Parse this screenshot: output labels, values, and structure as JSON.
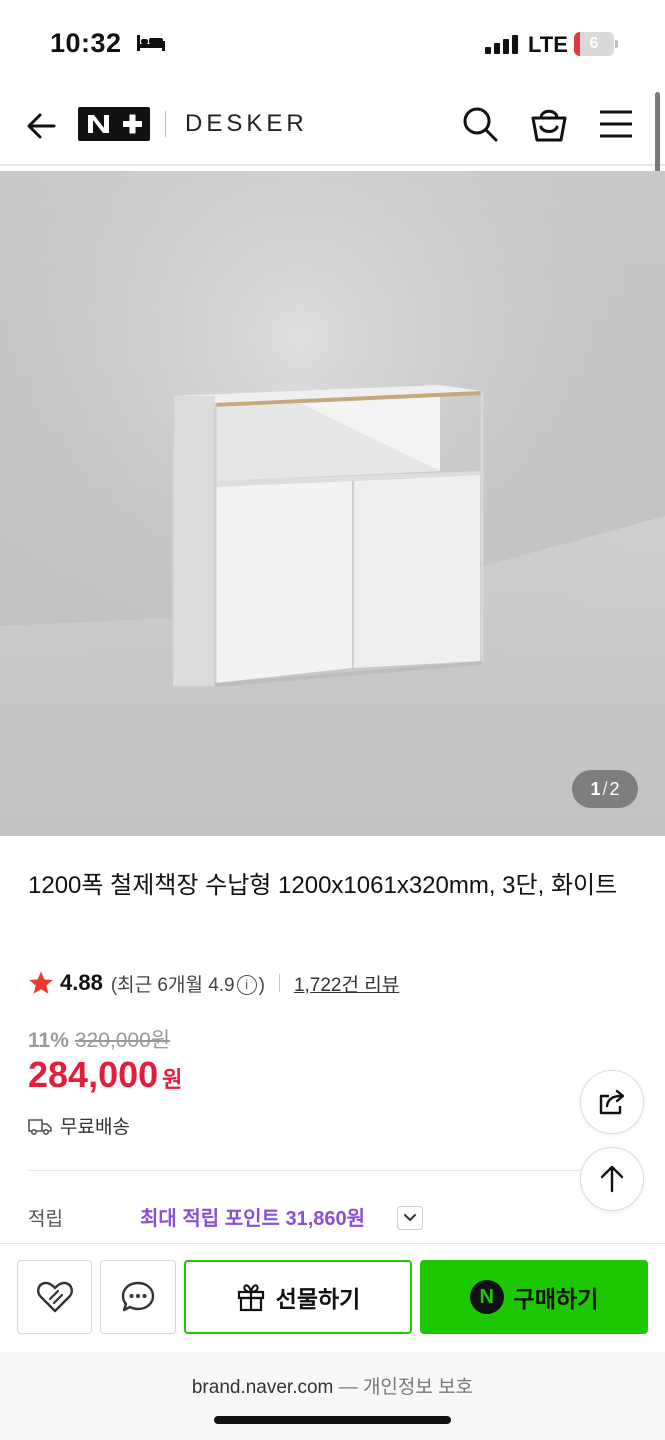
{
  "status_bar": {
    "time": "10:32",
    "network": "LTE",
    "battery_level": "6",
    "battery_color": "#e03a3a"
  },
  "header": {
    "logo_text": "N+",
    "brand": "DESKER",
    "icons": [
      "back-arrow-icon",
      "search-icon",
      "shopping-bag-icon",
      "hamburger-menu-icon"
    ]
  },
  "gallery": {
    "current": "1",
    "separator": "/",
    "total": "2"
  },
  "product": {
    "title": "1200폭 철제책장 수납형 1200x1061x320mm, 3단, 화이트",
    "rating": "4.88",
    "recent_rating_prefix": "(최근 6개월 4.9",
    "recent_rating_suffix": ")",
    "info_glyph": "i",
    "review_count": "1,722건 리뷰",
    "discount_rate": "11%",
    "original_price": "320,000원",
    "sale_price": "284,000",
    "currency": "원",
    "shipping": "무료배송",
    "points_label": "적립",
    "points_value": "최대 적립 포인트 31,860원"
  },
  "actions": {
    "gift_label": "선물하기",
    "buy_label": "구매하기",
    "npay_glyph": "N",
    "accent_color": "#1ec800"
  },
  "footer": {
    "domain": "brand.naver.com",
    "separator": " — ",
    "privacy": "개인정보 보호"
  },
  "colors": {
    "sale_price": "#e41d3c",
    "points": "#8a4fd6",
    "star": "#ef3b2c"
  }
}
